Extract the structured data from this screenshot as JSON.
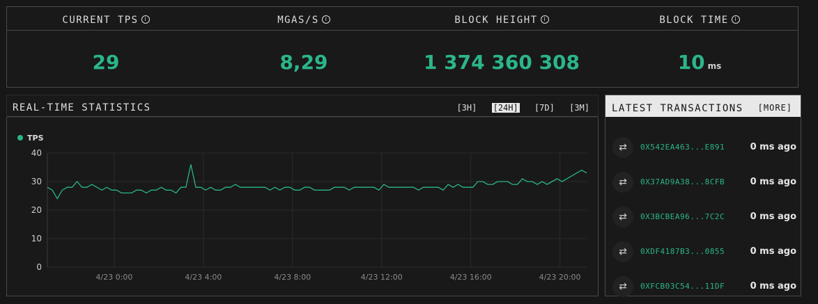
{
  "stats": [
    {
      "label": "CURRENT TPS",
      "value": "29",
      "unit": ""
    },
    {
      "label": "MGAS/S",
      "value": "8,29",
      "unit": ""
    },
    {
      "label": "BLOCK HEIGHT",
      "value": "1 374 360 308",
      "unit": ""
    },
    {
      "label": "BLOCK TIME",
      "value": "10",
      "unit": "ms"
    }
  ],
  "info_glyph": "i",
  "realtime": {
    "title": "REAL-TIME STATISTICS",
    "ranges": [
      "[3H]",
      "[24H]",
      "[7D]",
      "[3M]"
    ],
    "active_range": "[24H]"
  },
  "chart_data": {
    "type": "line",
    "legend": "TPS",
    "legend_color": "#2bb58a",
    "ylim": [
      0,
      40
    ],
    "yticks": [
      0,
      10,
      20,
      30,
      40
    ],
    "xticks": [
      "4/23 0:00",
      "4/23 4:00",
      "4/23 8:00",
      "4/23 12:00",
      "4/23 16:00",
      "4/23 20:00"
    ],
    "x_hours_range": [
      -3.0,
      21.2
    ],
    "series": [
      {
        "name": "TPS",
        "values": [
          28,
          27,
          24,
          27,
          28,
          28,
          30,
          28,
          28,
          29,
          28,
          27,
          28,
          27,
          27,
          26,
          26,
          26,
          27,
          27,
          26,
          27,
          27,
          28,
          27,
          27,
          26,
          28,
          28,
          36,
          28,
          28,
          27,
          28,
          27,
          27,
          28,
          28,
          29,
          28,
          28,
          28,
          28,
          28,
          28,
          27,
          28,
          27,
          28,
          28,
          27,
          27,
          28,
          28,
          27,
          27,
          27,
          27,
          28,
          28,
          28,
          27,
          28,
          28,
          28,
          28,
          28,
          27,
          29,
          28,
          28,
          28,
          28,
          28,
          28,
          27,
          28,
          28,
          28,
          28,
          27,
          29,
          28,
          29,
          28,
          28,
          28,
          30,
          30,
          29,
          29,
          30,
          30,
          30,
          29,
          29,
          31,
          30,
          30,
          29,
          30,
          29,
          30,
          31,
          30,
          31,
          32,
          33,
          34,
          33
        ]
      }
    ]
  },
  "latest": {
    "title": "LATEST TRANSACTIONS",
    "more": "[MORE]",
    "icon": "⇄",
    "rows": [
      {
        "hash": "0X542EA463...E891",
        "time": "0 ms ago"
      },
      {
        "hash": "0X37AD9A38...8CFB",
        "time": "0 ms ago"
      },
      {
        "hash": "0X3BCBEA96...7C2C",
        "time": "0 ms ago"
      },
      {
        "hash": "0XDF4187B3...0855",
        "time": "0 ms ago"
      },
      {
        "hash": "0XFCB03C54...11DF",
        "time": "0 ms ago"
      }
    ]
  }
}
